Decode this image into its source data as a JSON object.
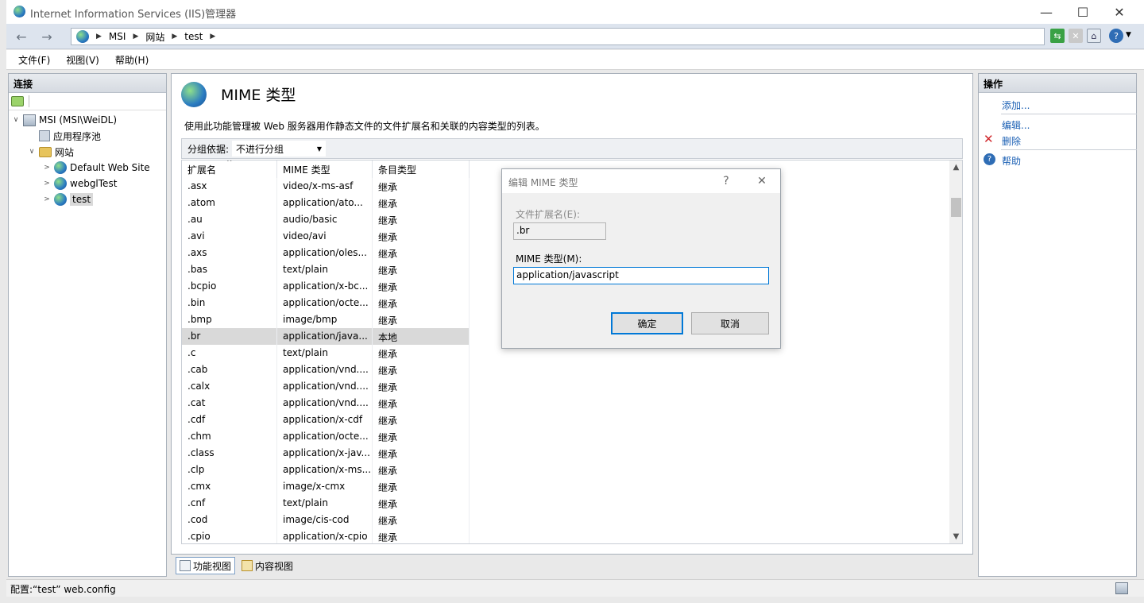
{
  "window": {
    "title": "Internet Information Services (IIS)管理器",
    "minimize": "—",
    "maximize": "☐",
    "close": "✕"
  },
  "address": {
    "back": "←",
    "forward": "→",
    "crumbs": [
      "MSI",
      "网站",
      "test"
    ],
    "separator": "▶"
  },
  "menu": [
    "文件(F)",
    "视图(V)",
    "帮助(H)"
  ],
  "connections": {
    "header": "连接",
    "tree": [
      {
        "label": "MSI (MSI\\WeiDL)",
        "twisty": "∨"
      },
      {
        "label": "应用程序池",
        "twisty": ""
      },
      {
        "label": "网站",
        "twisty": "∨"
      },
      {
        "label": "Default Web Site",
        "twisty": ">"
      },
      {
        "label": "webglTest",
        "twisty": ">"
      },
      {
        "label": "test",
        "twisty": ">"
      }
    ]
  },
  "feature": {
    "title": "MIME 类型",
    "description": "使用此功能管理被 Web 服务器用作静态文件的文件扩展名和关联的内容类型的列表。",
    "group_label": "分组依据:",
    "group_value": "不进行分组",
    "columns": [
      "扩展名",
      "MIME 类型",
      "条目类型"
    ],
    "rows": [
      [
        ".asx",
        "video/x-ms-asf",
        "继承"
      ],
      [
        ".atom",
        "application/ato...",
        "继承"
      ],
      [
        ".au",
        "audio/basic",
        "继承"
      ],
      [
        ".avi",
        "video/avi",
        "继承"
      ],
      [
        ".axs",
        "application/oles...",
        "继承"
      ],
      [
        ".bas",
        "text/plain",
        "继承"
      ],
      [
        ".bcpio",
        "application/x-bc...",
        "继承"
      ],
      [
        ".bin",
        "application/octe...",
        "继承"
      ],
      [
        ".bmp",
        "image/bmp",
        "继承"
      ],
      [
        ".br",
        "application/java...",
        "本地"
      ],
      [
        ".c",
        "text/plain",
        "继承"
      ],
      [
        ".cab",
        "application/vnd....",
        "继承"
      ],
      [
        ".calx",
        "application/vnd....",
        "继承"
      ],
      [
        ".cat",
        "application/vnd....",
        "继承"
      ],
      [
        ".cdf",
        "application/x-cdf",
        "继承"
      ],
      [
        ".chm",
        "application/octe...",
        "继承"
      ],
      [
        ".class",
        "application/x-jav...",
        "继承"
      ],
      [
        ".clp",
        "application/x-ms...",
        "继承"
      ],
      [
        ".cmx",
        "image/x-cmx",
        "继承"
      ],
      [
        ".cnf",
        "text/plain",
        "继承"
      ],
      [
        ".cod",
        "image/cis-cod",
        "继承"
      ],
      [
        ".cpio",
        "application/x-cpio",
        "继承"
      ]
    ],
    "selected_row": ".br",
    "views": [
      "功能视图",
      "内容视图"
    ]
  },
  "actions": {
    "header": "操作",
    "add": "添加...",
    "edit": "编辑...",
    "delete": "删除",
    "help": "帮助"
  },
  "status": {
    "text": "配置:“test” web.config"
  },
  "dialog": {
    "title": "编辑 MIME 类型",
    "help_glyph": "?",
    "close_glyph": "✕",
    "ext_label": "文件扩展名(E):",
    "ext_value": ".br",
    "mime_label": "MIME 类型(M):",
    "mime_value": "application/javascript",
    "ok": "确定",
    "cancel": "取消"
  }
}
